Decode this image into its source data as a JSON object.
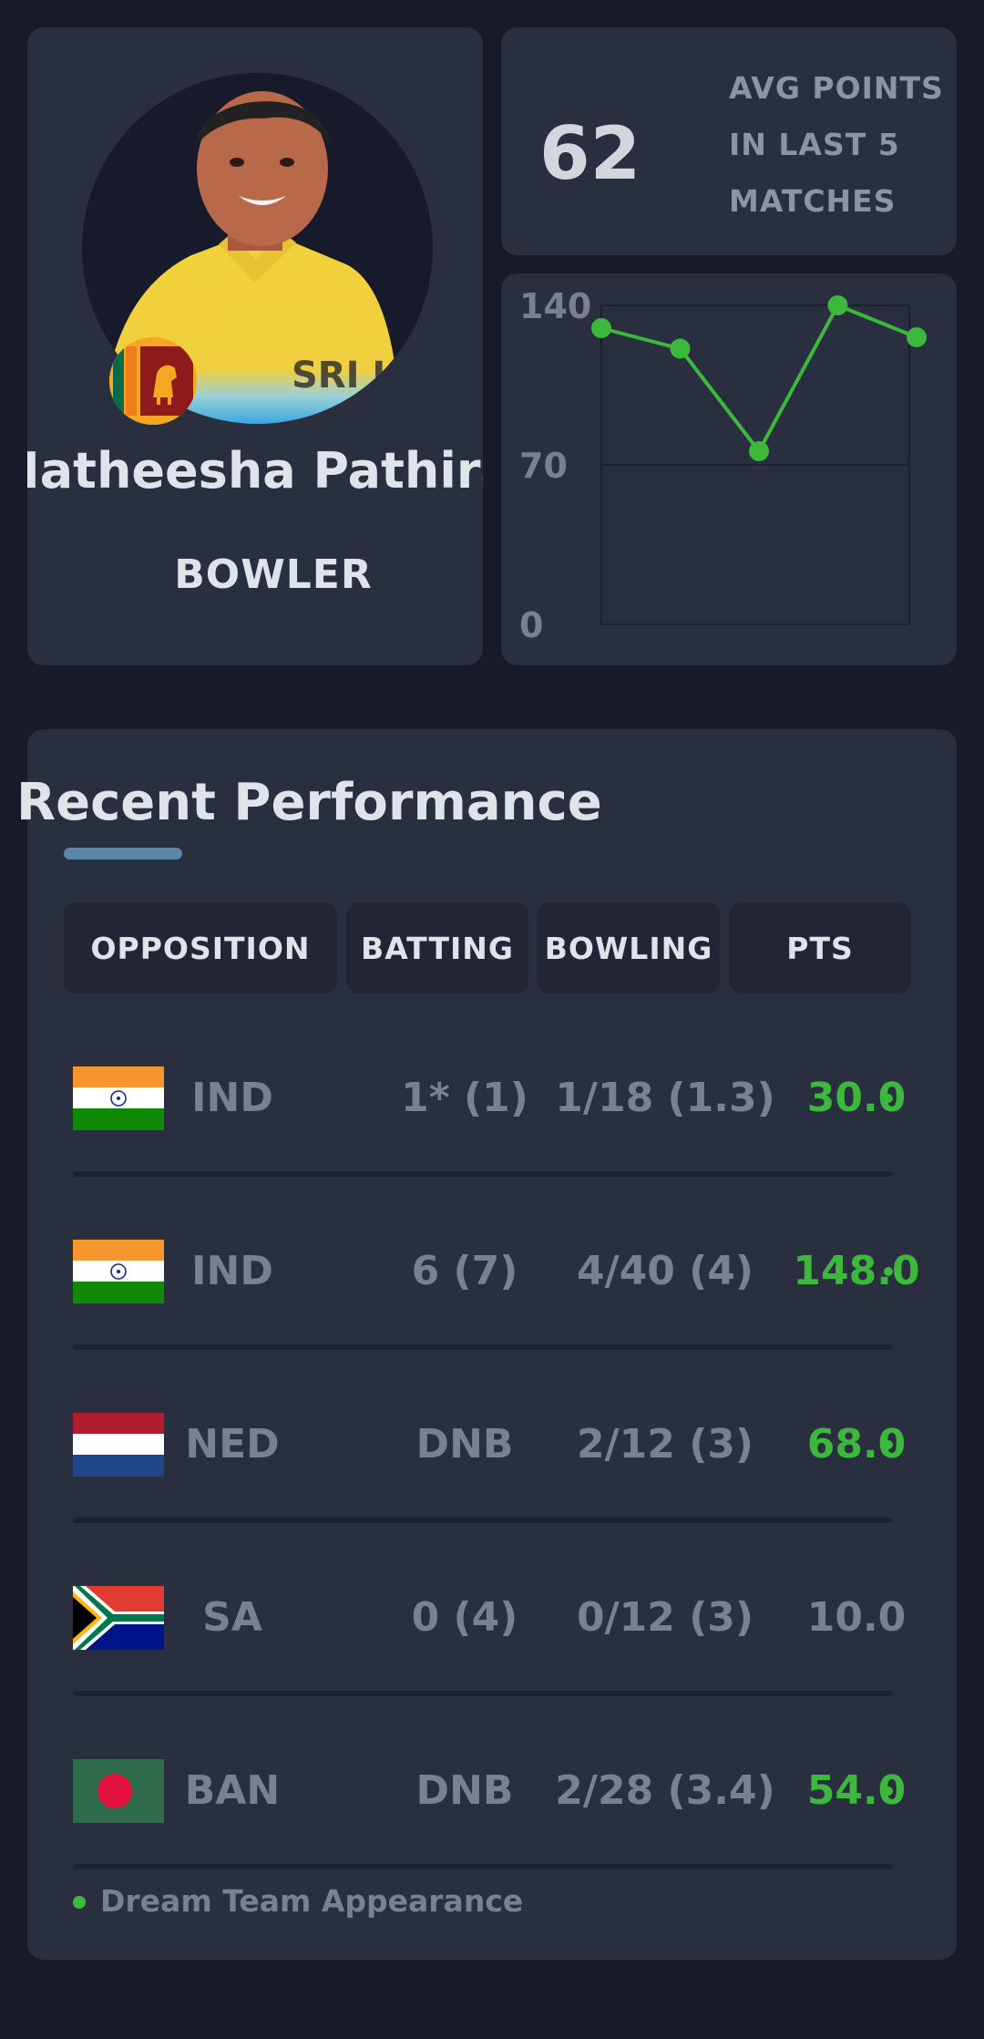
{
  "player": {
    "name": "Matheesha Pathirana",
    "role": "BOWLER",
    "country_flag": "sri-lanka-flag"
  },
  "stats": {
    "avg_points": "62",
    "avg_label": "AVG POINTS IN LAST 5 MATCHES"
  },
  "colors": {
    "accent_green": "#3cb93c",
    "underline": "#5b86a8"
  },
  "chart_data": {
    "type": "line",
    "ylim": [
      0,
      140
    ],
    "yticks": [
      "140",
      "70",
      "0"
    ],
    "values": [
      130,
      121,
      76,
      140,
      126
    ],
    "grid": true
  },
  "performance": {
    "title": "Recent Performance",
    "headers": {
      "opposition": "OPPOSITION",
      "batting": "BATTING",
      "bowling": "BOWLING",
      "pts": "PTS"
    },
    "rows": [
      {
        "team": "IND",
        "flag": "india",
        "batting": "1* (1)",
        "bowling": "1/18 (1.3)",
        "pts": "30.0",
        "dream_team": true
      },
      {
        "team": "IND",
        "flag": "india",
        "batting": "6 (7)",
        "bowling": "4/40 (4)",
        "pts": "148.0",
        "dream_team": true
      },
      {
        "team": "NED",
        "flag": "netherlands",
        "batting": "DNB",
        "bowling": "2/12 (3)",
        "pts": "68.0",
        "dream_team": true
      },
      {
        "team": "SA",
        "flag": "south-africa",
        "batting": "0 (4)",
        "bowling": "0/12 (3)",
        "pts": "10.0",
        "dream_team": false
      },
      {
        "team": "BAN",
        "flag": "bangladesh",
        "batting": "DNB",
        "bowling": "2/28 (3.4)",
        "pts": "54.0",
        "dream_team": true
      }
    ],
    "legend": "Dream Team Appearance"
  }
}
